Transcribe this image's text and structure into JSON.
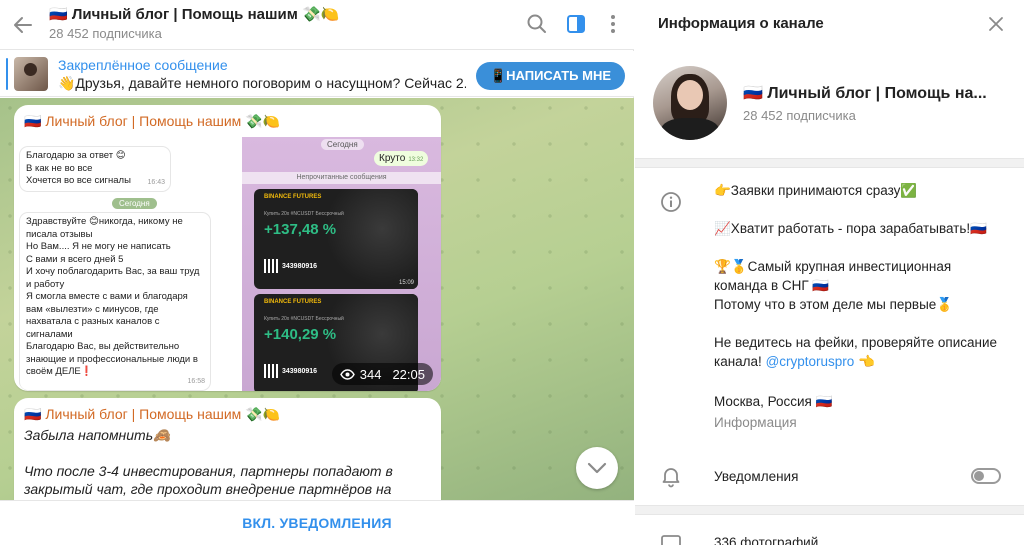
{
  "chat": {
    "title": "🇷🇺 Личный блог | Помощь нашим 💸🍋",
    "subscribers": "28 452 подписчика",
    "pinned": {
      "title": "Закреплённое сообщение",
      "text": "👋Друзья, давайте немного поговорим о насущном? Сейчас 2...",
      "button": "📱НАПИСАТЬ МНЕ"
    },
    "post1": {
      "author": "🇷🇺 Личный блог | Помощь нашим 💸🍋",
      "screenshot_left": {
        "bubble1": "Благодарю за ответ 😊\nВ как не во все\nХочется во все сигналы",
        "bubble1_time": "16:43",
        "date": "Сегодня",
        "bubble2": "Здравствуйте 😊никогда, никому не писала отзывы\nНо Вам.... Я не могу не написать\nС вами я всего дней 5\nИ хочу поблагодарить Вас, за ваш труд и работу\nЯ смогла вместе с вами и благодаря вам «вылезти» с минусов, где нахватала с разных каналов с сигналами\nБлагодарю Вас, вы действительно знающие и профессиональные люди в своём ДЕЛЕ❗",
        "bubble2_time": "16:58"
      },
      "screenshot_right": {
        "date": "Сегодня",
        "reply": "Круто",
        "reply_time": "13:32",
        "unread": "Непрочитанные сообщения",
        "cards": [
          {
            "brand": "BINANCE FUTURES",
            "pair": "Купить  20x  #NCUSDT Бессрочный",
            "percent": "+137,48 %",
            "code": "343980916",
            "time": "15:09"
          },
          {
            "brand": "BINANCE FUTURES",
            "pair": "Купить  20x  #NCUSDT Бессрочный",
            "percent": "+140,29 %",
            "code": "343980916",
            "time": ""
          }
        ]
      },
      "views": "344",
      "time": "22:05"
    },
    "post2": {
      "author": "🇷🇺 Личный блог | Помощь нашим 💸🍋",
      "line1": "Забыла напомнить🙈",
      "line2": "Что после 3-4 инвестирования, партнеры попадают в закрытый чат, где проходит внедрение партнёров на биржу и обучение работы с торгами"
    },
    "bottom_button": "ВКЛ. УВЕДОМЛЕНИЯ"
  },
  "info": {
    "header": "Информация о канале",
    "name": "🇷🇺 Личный блог | Помощь на...",
    "subscribers": "28 452 подписчика",
    "description": [
      "👉Заявки принимаются сразу✅",
      "📈Хватит работать - пора зарабатывать!🇷🇺",
      "🏆🥇Самый крупная инвестиционная команда в СНГ 🇷🇺\nПотому что в этом деле мы первые🥇",
      "Не ведитесь на фейки, проверяйте описание канала!"
    ],
    "link": "@cryptoruspro",
    "link_suffix": " 👈",
    "location": "Москва, Россия 🇷🇺",
    "location_label": "Информация",
    "notifications_label": "Уведомления",
    "notifications_on": false,
    "photos": "336 фотографий"
  },
  "colors": {
    "accent": "#3390ec",
    "author": "#d26a25",
    "write_button": "#3a8fd9",
    "profit_green": "#2ebd85"
  }
}
